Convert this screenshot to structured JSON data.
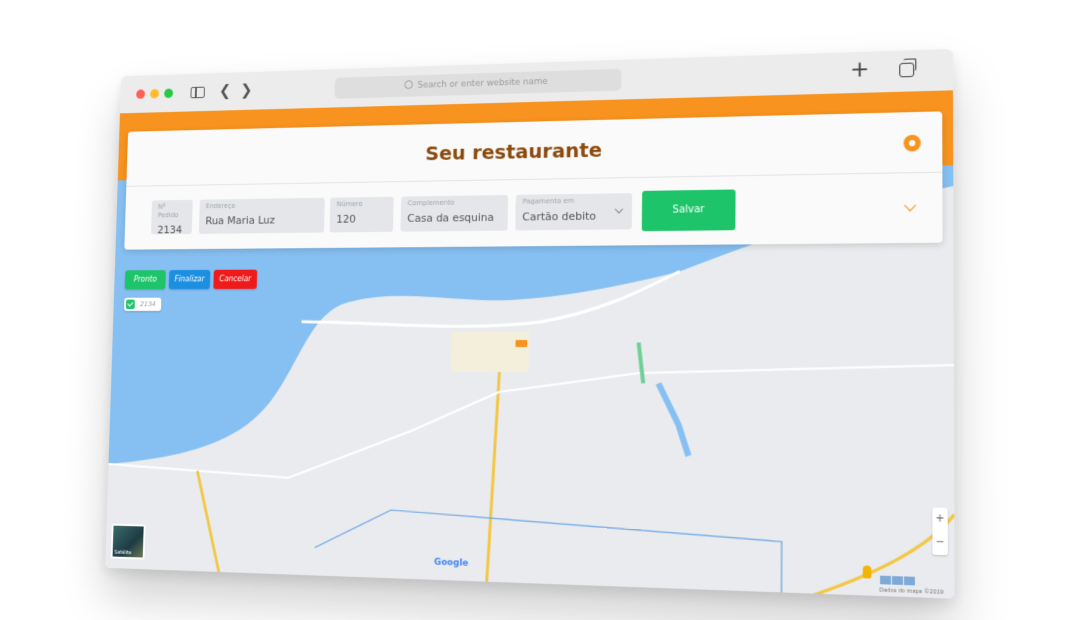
{
  "browser": {
    "address_placeholder": "Search or enter website name"
  },
  "header": {
    "title": "Seu restaurante"
  },
  "form": {
    "pedido": {
      "label": "Nº Pedido",
      "value": "2134"
    },
    "endereco": {
      "label": "Endereço",
      "value": "Rua Maria Luz"
    },
    "numero": {
      "label": "Número",
      "value": "120"
    },
    "complemento": {
      "label": "Complemento",
      "value": "Casa da esquina"
    },
    "pagamento": {
      "label": "Pagamento em",
      "value": "Cartão debito"
    },
    "save_label": "Salvar"
  },
  "actions": {
    "pronto": "Pronto",
    "finalizar": "Finalizar",
    "cancelar": "Cancelar"
  },
  "orders": [
    {
      "id": "2134",
      "checked": true
    }
  ],
  "map": {
    "provider": "Google",
    "satellite_label": "Satélite",
    "zoom_in": "+",
    "zoom_out": "−",
    "attribution": "Dados do mapa ©2019"
  },
  "colors": {
    "accent": "#f7931e",
    "title": "#8b4a0c",
    "success": "#1ec46a",
    "info": "#1d8fe0",
    "danger": "#ef1a1a",
    "water": "#86bff2"
  }
}
